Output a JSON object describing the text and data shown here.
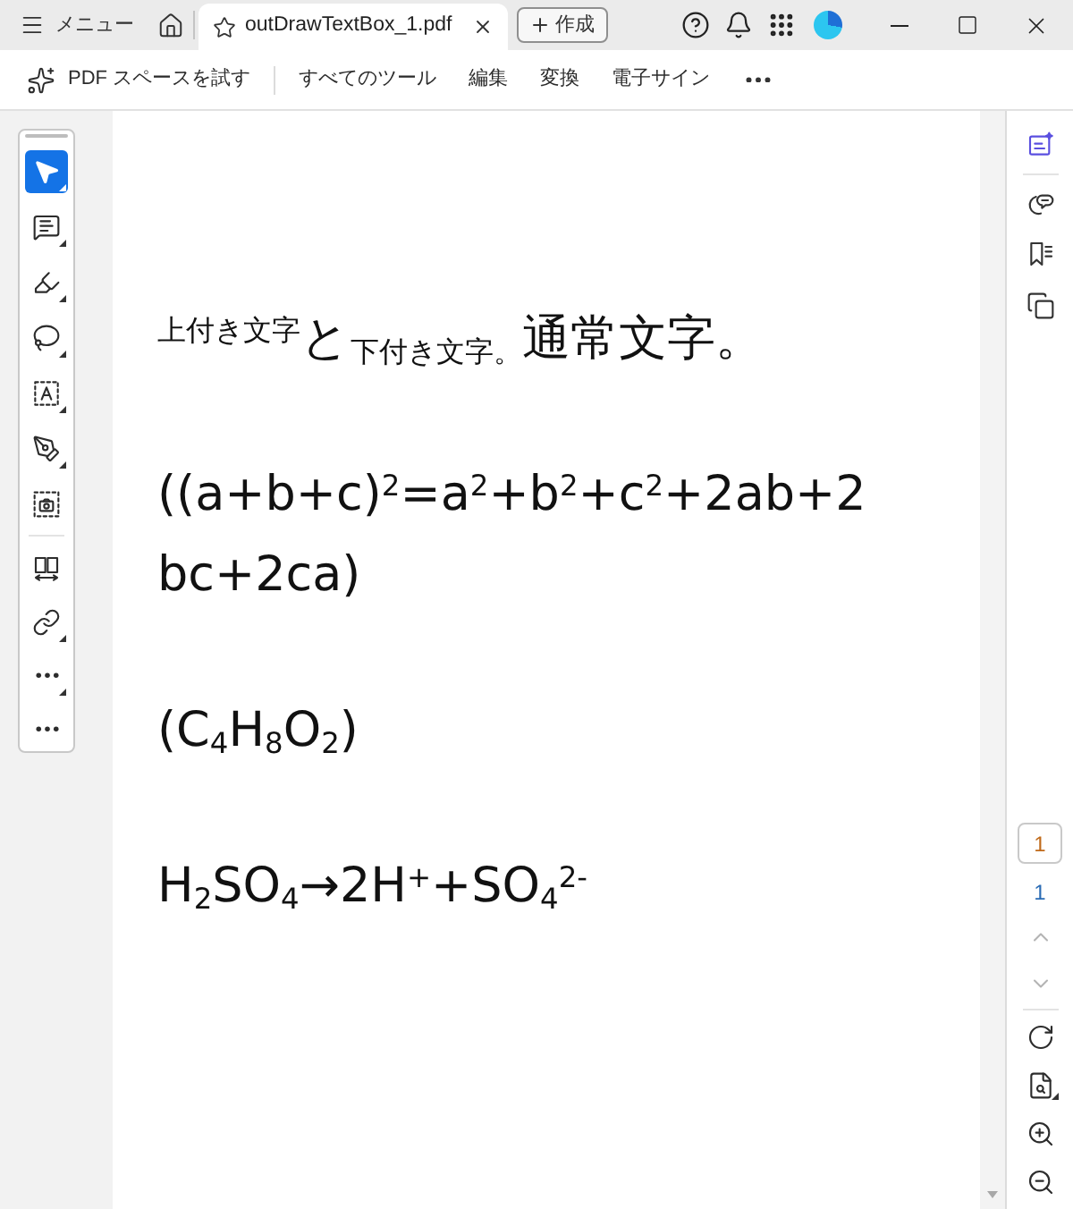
{
  "title_bar": {
    "menu_label": "メニュー",
    "tabs": [
      {
        "label": "outDrawTextBox_1.pdf",
        "selected": true
      }
    ],
    "create_label": "作成"
  },
  "toolbar": {
    "try_label": "PDF スペースを試す",
    "items": [
      "すべてのツール",
      "編集",
      "変換",
      "電子サイン"
    ]
  },
  "tool_groups": [
    [
      {
        "kind": "select",
        "selected": true,
        "submenu": true
      },
      {
        "kind": "comment",
        "selected": false,
        "submenu": true
      },
      {
        "kind": "draw",
        "selected": false,
        "submenu": true
      },
      {
        "kind": "lasso",
        "selected": false,
        "submenu": true
      },
      {
        "kind": "text_box",
        "selected": false,
        "submenu": true
      },
      {
        "kind": "fill_sign",
        "selected": false,
        "submenu": true
      },
      {
        "kind": "snapshot",
        "selected": false,
        "submenu": false
      }
    ],
    [
      {
        "kind": "compare",
        "selected": false,
        "submenu": false
      },
      {
        "kind": "link",
        "selected": false,
        "submenu": true
      },
      {
        "kind": "more",
        "selected": false,
        "submenu": true
      },
      {
        "kind": "more",
        "selected": false,
        "submenu": false
      }
    ]
  ],
  "document": {
    "paragraphs": [
      {
        "lines": [
          "$^{上付き文字}$と$_{下付き文字。}$通常文字。"
        ]
      },
      {
        "lines": [
          "((a+b+c)$^{2}$=a$^{2}$+b$^{2}$+c$^{2}$+2ab+2",
          "bc+2ca)"
        ]
      },
      {
        "lines": [
          "(C$_{4}$H$_{8}$O$_{2}$)"
        ]
      },
      {
        "lines": [
          "H$_{2}$SO$_{4}$→2H$^{+}$+SO$_{4}$$^{2-}$"
        ]
      }
    ]
  },
  "side_panel": {
    "tools": [
      {
        "kind": "ai_assistant"
      },
      {
        "kind": "comments"
      },
      {
        "kind": "bookmarks"
      },
      {
        "kind": "pages"
      }
    ]
  },
  "page_nav": {
    "page_field": "1",
    "page_count": "1",
    "previous_disabled": true,
    "next_disabled": true
  },
  "view_tools": [
    {
      "kind": "rotate",
      "submenu": false
    },
    {
      "kind": "page_search",
      "submenu": true
    },
    {
      "kind": "zoom_in",
      "submenu": false
    },
    {
      "kind": "zoom_out",
      "submenu": false
    }
  ]
}
